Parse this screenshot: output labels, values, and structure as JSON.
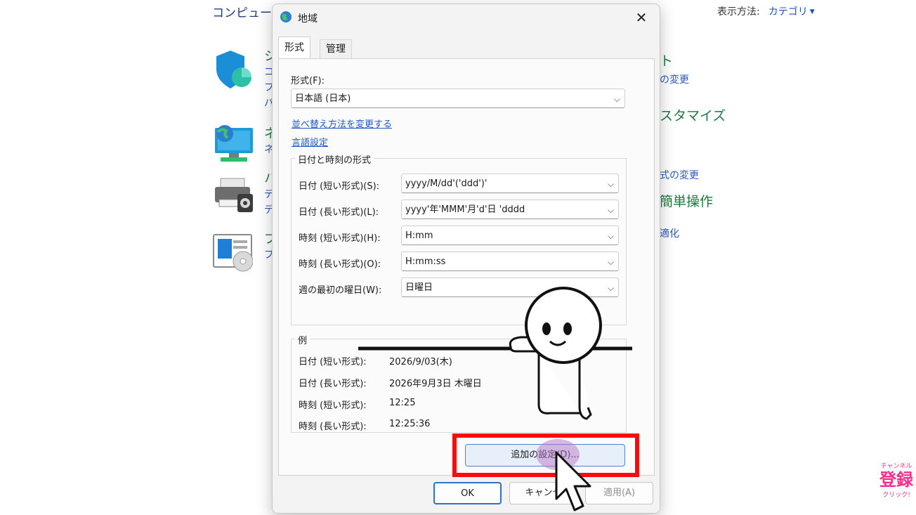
{
  "control_panel": {
    "title": "コンピュータ",
    "view_by_label": "表示方法:",
    "view_by_value": "カテゴリ",
    "left_fragments": [
      [
        "シ",
        "コ",
        "フ",
        "パ"
      ],
      [
        "ネ",
        "ネ"
      ],
      [
        "ハ",
        "デ",
        "デ"
      ],
      [
        "プ",
        "プ"
      ]
    ],
    "right_items": [
      {
        "text": "ト",
        "kind": "head"
      },
      {
        "text": "の変更",
        "kind": "link"
      },
      {
        "text": "スタマイズ",
        "kind": "head"
      },
      {
        "text": "式の変更",
        "kind": "link"
      },
      {
        "text": "簡単操作",
        "kind": "head"
      },
      {
        "text": "適化",
        "kind": "link"
      }
    ],
    "icons": [
      "shield-icon",
      "network-globe-icon",
      "printer-icon",
      "programs-disc-icon"
    ]
  },
  "dialog": {
    "title": "地域",
    "close_glyph": "✕",
    "tabs": [
      {
        "label": "形式"
      },
      {
        "label": "管理"
      }
    ],
    "format": {
      "label": "形式(F):",
      "value": "日本語 (日本)",
      "link_sort": "並べ替え方法を変更する",
      "link_language": "言語設定"
    },
    "datetime_group": {
      "title": "日付と時刻の形式",
      "rows": [
        {
          "label": "日付 (短い形式)(S):",
          "value": "yyyy/M/dd'('ddd')'"
        },
        {
          "label": "日付 (長い形式)(L):",
          "value": "yyyy'年'MMM'月'd'日 'dddd"
        },
        {
          "label": "時刻 (短い形式)(H):",
          "value": "H:mm"
        },
        {
          "label": "時刻 (長い形式)(O):",
          "value": "H:mm:ss"
        },
        {
          "label": "週の最初の曜日(W):",
          "value": "日曜日"
        }
      ]
    },
    "example_group": {
      "title": "例",
      "rows": [
        {
          "label": "日付 (短い形式):",
          "value": "2026/9/03(木)"
        },
        {
          "label": "日付 (長い形式):",
          "value": "2026年9月3日 木曜日"
        },
        {
          "label": "時刻 (短い形式):",
          "value": "12:25"
        },
        {
          "label": "時刻 (長い形式):",
          "value": "12:25:36"
        }
      ]
    },
    "additional_settings_button": "追加の設定(D)...",
    "ok_button": "OK",
    "cancel_button": "キャンセ",
    "apply_button": "適用(A)"
  },
  "overlay": {
    "subscribe_top": "チャンネル",
    "subscribe_main": "登録",
    "subscribe_bottom": "クリック!",
    "highlight_color": "#ff0a0a"
  }
}
